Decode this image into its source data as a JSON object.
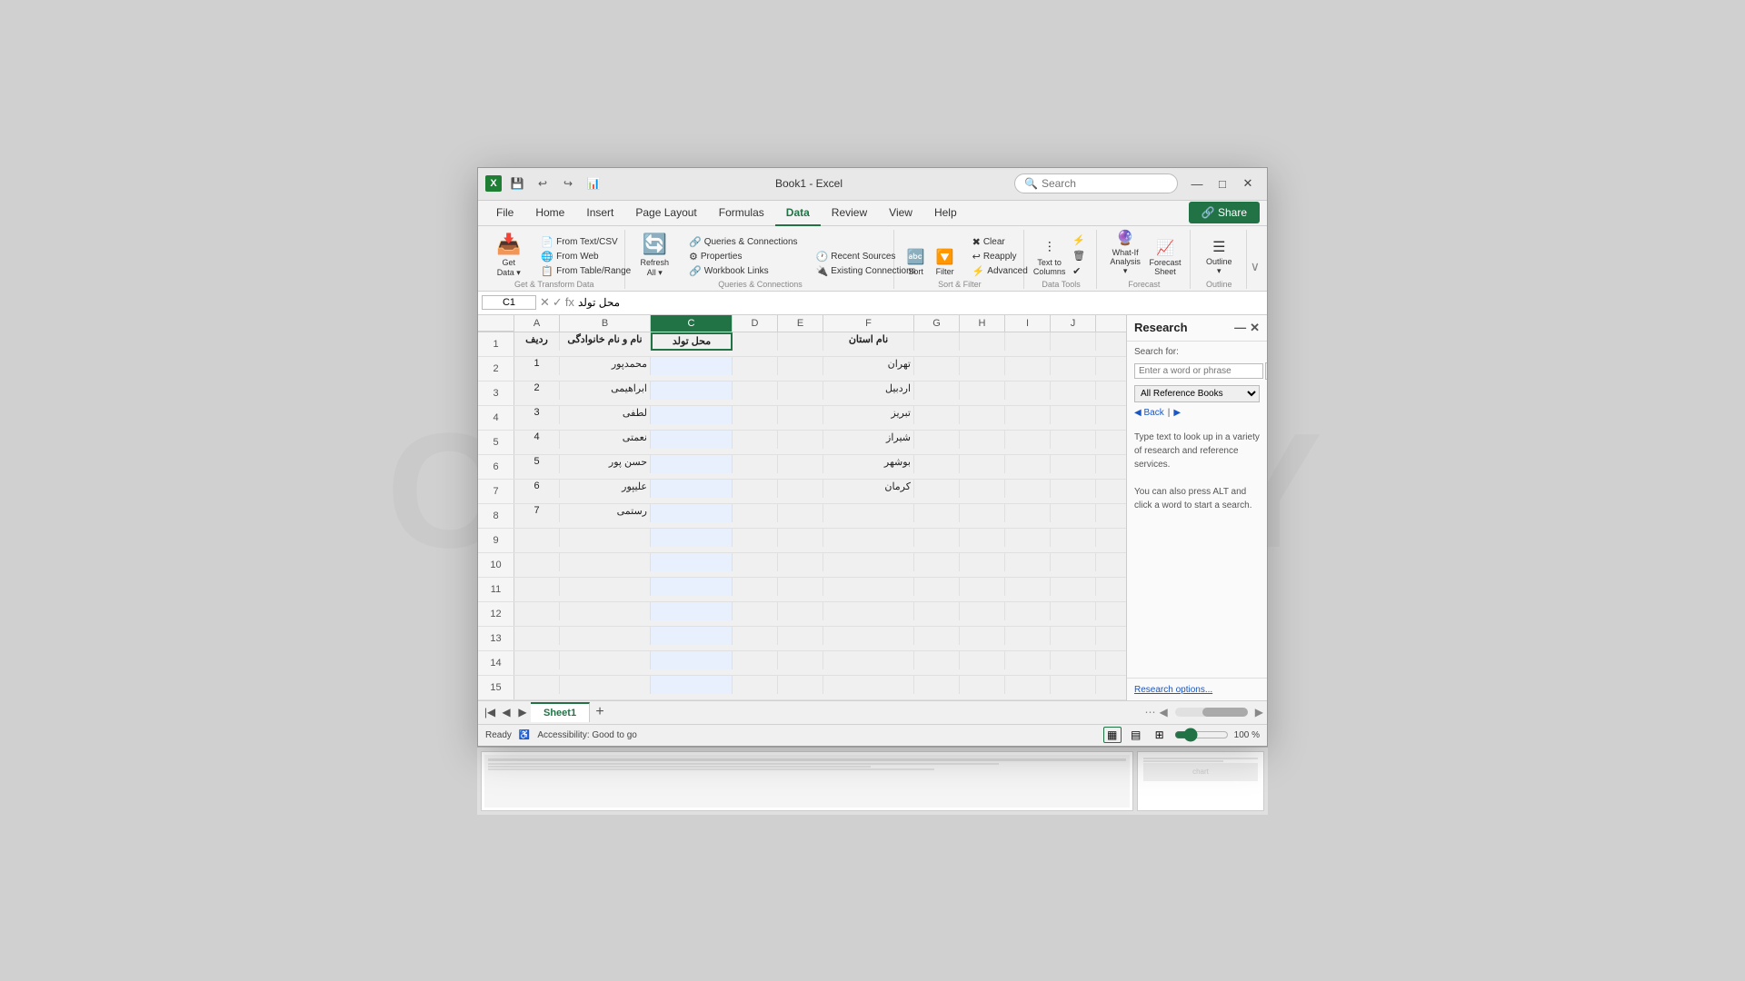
{
  "window": {
    "title": "Book1 - Excel",
    "icon": "X"
  },
  "titlebar": {
    "save_label": "💾",
    "undo_label": "↩",
    "redo_label": "↪",
    "chart_icon": "📊",
    "minimize": "—",
    "maximize": "□",
    "close": "✕"
  },
  "search": {
    "placeholder": "Search"
  },
  "tabs": {
    "items": [
      "File",
      "Home",
      "Insert",
      "Page Layout",
      "Formulas",
      "Data",
      "Review",
      "View",
      "Help"
    ],
    "active": "Data"
  },
  "share_button": "🔗 Share",
  "ribbon": {
    "groups": [
      {
        "label": "Get & Transform Data",
        "buttons_large": [
          {
            "id": "get-data",
            "ico": "📥",
            "label": "Get\nData"
          }
        ],
        "buttons_small": [
          {
            "id": "from-text-csv",
            "ico": "📄",
            "label": "From Text/CSV"
          },
          {
            "id": "from-web",
            "ico": "🌐",
            "label": "From Web"
          },
          {
            "id": "from-table",
            "ico": "📋",
            "label": "From Table/Range"
          }
        ]
      },
      {
        "label": "Queries & Connections",
        "buttons_large": [
          {
            "id": "refresh-all",
            "ico": "🔄",
            "label": "Refresh\nAll"
          }
        ],
        "buttons_small": [
          {
            "id": "queries-connections",
            "ico": "🔗",
            "label": "Queries & Connections"
          },
          {
            "id": "properties",
            "ico": "⚙",
            "label": "Properties"
          },
          {
            "id": "workbook-links",
            "ico": "🔗",
            "label": "Workbook Links"
          },
          {
            "id": "recent-sources",
            "ico": "🕐",
            "label": "Recent Sources"
          },
          {
            "id": "existing-connections",
            "ico": "🔌",
            "label": "Existing Connections"
          }
        ]
      },
      {
        "label": "Sort & Filter",
        "buttons_large": [
          {
            "id": "sort-az",
            "ico": "↕",
            "label": "Sort"
          },
          {
            "id": "filter",
            "ico": "🔽",
            "label": "Filter"
          }
        ],
        "buttons_small": [
          {
            "id": "clear",
            "ico": "✖",
            "label": "Clear"
          },
          {
            "id": "reapply",
            "ico": "↩",
            "label": "Reapply"
          },
          {
            "id": "advanced",
            "ico": "⚡",
            "label": "Advanced"
          }
        ]
      },
      {
        "label": "Data Tools",
        "buttons_large": [
          {
            "id": "text-to-columns",
            "ico": "⫶",
            "label": "Text to\nColumns"
          }
        ],
        "buttons_small": []
      },
      {
        "label": "Forecast",
        "buttons_large": [
          {
            "id": "what-if",
            "ico": "🔮",
            "label": "What-If\nAnalysis"
          },
          {
            "id": "forecast-sheet",
            "ico": "📈",
            "label": "Forecast\nSheet"
          }
        ],
        "buttons_small": []
      },
      {
        "label": "Outline",
        "buttons_large": [
          {
            "id": "outline",
            "ico": "☰",
            "label": "Outline"
          }
        ],
        "buttons_small": []
      }
    ]
  },
  "formula_bar": {
    "name_box": "C1",
    "formula_content": "محل تولد"
  },
  "columns": {
    "headers": [
      "A",
      "B",
      "C",
      "D",
      "E",
      "F",
      "G",
      "H",
      "I",
      "J"
    ]
  },
  "spreadsheet": {
    "col_a_label": "ردیف",
    "col_b_label": "نام و نام خانوادگی",
    "col_c_label": "محل تولد",
    "col_f_label": "نام استان",
    "rows": [
      {
        "num": "2",
        "a": "1",
        "b": "محمدپور",
        "c": "",
        "f": "تهران"
      },
      {
        "num": "3",
        "a": "2",
        "b": "ابراهیمی",
        "c": "",
        "f": "اردبیل"
      },
      {
        "num": "4",
        "a": "3",
        "b": "لطفی",
        "c": "",
        "f": "تبریز"
      },
      {
        "num": "5",
        "a": "4",
        "b": "نعمتی",
        "c": "",
        "f": "شیراز"
      },
      {
        "num": "6",
        "a": "5",
        "b": "حسن پور",
        "c": "",
        "f": "بوشهر"
      },
      {
        "num": "7",
        "a": "6",
        "b": "علیپور",
        "c": "",
        "f": "کرمان"
      },
      {
        "num": "8",
        "a": "7",
        "b": "رستمی",
        "c": "",
        "f": ""
      },
      {
        "num": "9",
        "a": "",
        "b": "",
        "c": "",
        "f": ""
      },
      {
        "num": "10",
        "a": "",
        "b": "",
        "c": "",
        "f": ""
      },
      {
        "num": "11",
        "a": "",
        "b": "",
        "c": "",
        "f": ""
      },
      {
        "num": "12",
        "a": "",
        "b": "",
        "c": "",
        "f": ""
      },
      {
        "num": "13",
        "a": "",
        "b": "",
        "c": "",
        "f": ""
      },
      {
        "num": "14",
        "a": "",
        "b": "",
        "c": "",
        "f": ""
      },
      {
        "num": "15",
        "a": "",
        "b": "",
        "c": "",
        "f": ""
      }
    ]
  },
  "research_panel": {
    "title": "Research",
    "search_label": "Search for:",
    "search_placeholder": "Enter a word or phrase",
    "dropdown_value": "All Reference Books",
    "back_label": "Back",
    "forward_label": "▶",
    "info_text": "Type text to look up in a variety of research and reference services.\n\nYou can also press ALT and click a word to start a search.",
    "options_label": "Research options..."
  },
  "sheet_tabs": {
    "items": [
      "Sheet1"
    ],
    "active": "Sheet1"
  },
  "status_bar": {
    "ready": "Ready",
    "accessibility": "Accessibility: Good to go",
    "zoom": "100 %"
  }
}
